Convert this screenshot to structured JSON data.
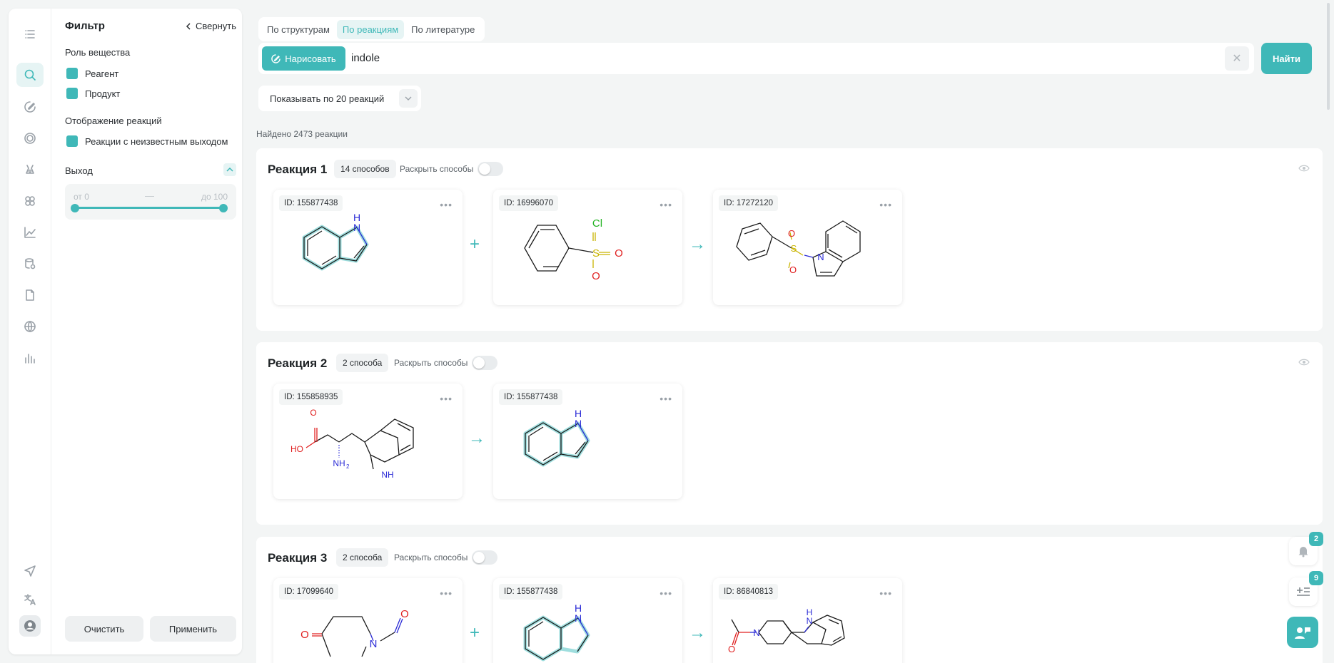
{
  "rail": {
    "icons": [
      "list-icon",
      "search-icon",
      "draw-icon",
      "target-icon",
      "flask-icon",
      "molecules-icon",
      "chart-icon",
      "database-icon",
      "document-icon",
      "globe-icon",
      "stats-icon",
      "send-icon",
      "translate-icon",
      "user-icon"
    ]
  },
  "filter": {
    "title": "Фильтр",
    "collapse_label": "Свернуть",
    "role_label": "Роль вещества",
    "role_options": [
      "Реагент",
      "Продукт"
    ],
    "display_label": "Отображение реакций",
    "display_options": [
      "Реакции с неизвестным выходом"
    ],
    "yield_label": "Выход",
    "yield_from": "от 0",
    "yield_to": "до 100",
    "yield_sep": "—",
    "clear_label": "Очистить",
    "apply_label": "Применить"
  },
  "tabs": [
    "По структурам",
    "По реакциям",
    "По литературе"
  ],
  "search": {
    "draw_label": "Нарисовать",
    "query": "indole",
    "find_label": "Найти"
  },
  "pager_label": "Показывать по 20 реакций",
  "found_text": "Найдено 2473 реакции",
  "reactions": [
    {
      "title": "Реакция 1",
      "methods": "14 способов",
      "expand_label": "Раскрыть способы",
      "molecules": [
        {
          "id": "ID: 155877438"
        },
        {
          "id": "ID: 16996070"
        },
        {
          "id": "ID: 17272120"
        }
      ]
    },
    {
      "title": "Реакция 2",
      "methods": "2 способа",
      "expand_label": "Раскрыть способы",
      "molecules": [
        {
          "id": "ID: 155858935"
        },
        {
          "id": "ID: 155877438"
        }
      ]
    },
    {
      "title": "Реакция 3",
      "methods": "2 способа",
      "expand_label": "Раскрыть способы",
      "molecules": [
        {
          "id": "ID: 17099640"
        },
        {
          "id": "ID: 155877438"
        },
        {
          "id": "ID: 86840813"
        }
      ]
    }
  ],
  "atoms": {
    "n": "N",
    "nh": "NH",
    "h": "H",
    "s": "S",
    "o": "O",
    "cl": "Cl",
    "ho": "HO",
    "nh2": "NH",
    "sub2": "2"
  },
  "notifications": {
    "bell_count": "2",
    "list_count": "9"
  },
  "colors": {
    "accent": "#3fb8b8",
    "oxygen": "#e02020",
    "nitrogen": "#2a2ad6",
    "sulfur": "#c9b400",
    "chlorine": "#22b322"
  }
}
